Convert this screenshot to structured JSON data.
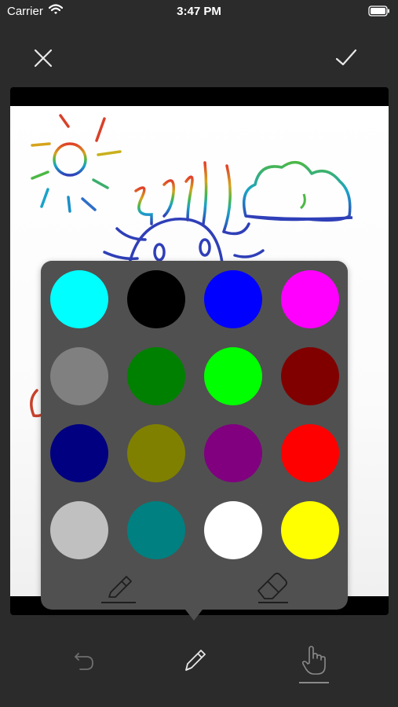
{
  "status_bar": {
    "carrier": "Carrier",
    "time": "3:47 PM"
  },
  "header": {
    "close_icon": "close-icon",
    "done_icon": "checkmark-icon"
  },
  "palette": {
    "colors": [
      "#00ffff",
      "#000000",
      "#0000ff",
      "#ff00ff",
      "#808080",
      "#008000",
      "#00ff00",
      "#800000",
      "#000080",
      "#808000",
      "#800080",
      "#ff0000",
      "#c0c0c0",
      "#008080",
      "#ffffff",
      "#ffff00"
    ],
    "tools": [
      "highlighter-icon",
      "eraser-icon"
    ]
  },
  "toolbar": {
    "items": [
      "undo-icon",
      "pencil-icon",
      "hand-pointer-icon"
    ],
    "active": "hand-pointer-icon"
  }
}
